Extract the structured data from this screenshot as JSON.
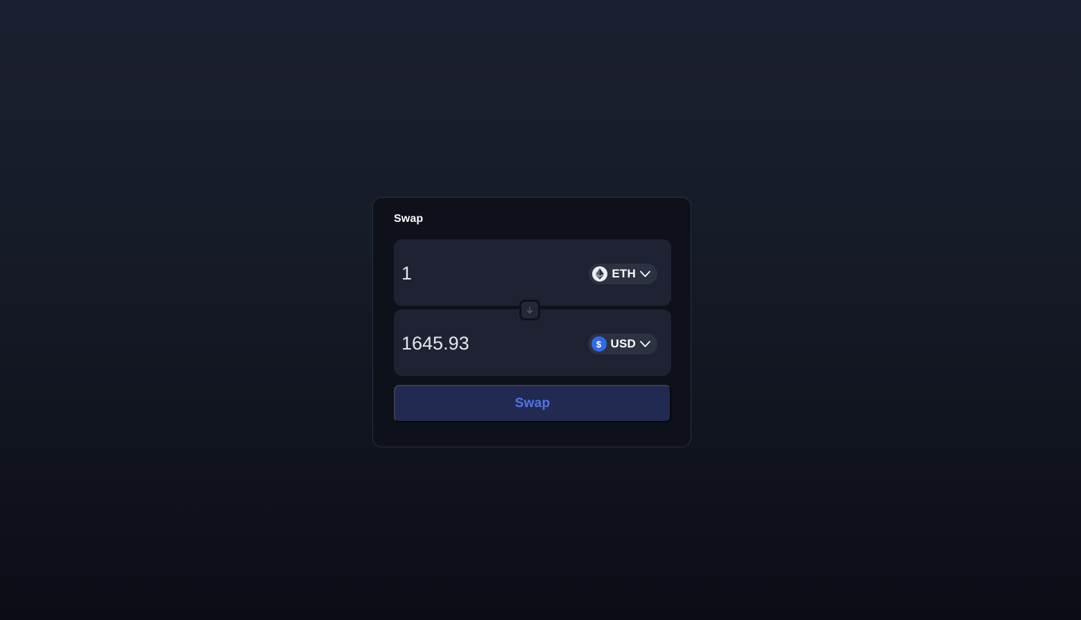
{
  "swap_card": {
    "title": "Swap",
    "from": {
      "amount": "1",
      "token_symbol": "ETH",
      "token_icon": "ethereum-icon"
    },
    "to": {
      "amount": "1645.93",
      "token_symbol": "USD",
      "token_icon": "dollar-icon",
      "icon_glyph": "$"
    },
    "switch_icon": "arrow-down-icon",
    "swap_button_label": "Swap"
  },
  "colors": {
    "card_background": "#0e1119",
    "panel_background": "#1e2232",
    "selector_background": "#2d3243",
    "button_background": "#222a52",
    "button_text": "#4f74e8",
    "usd_icon": "#2f6ae8"
  }
}
